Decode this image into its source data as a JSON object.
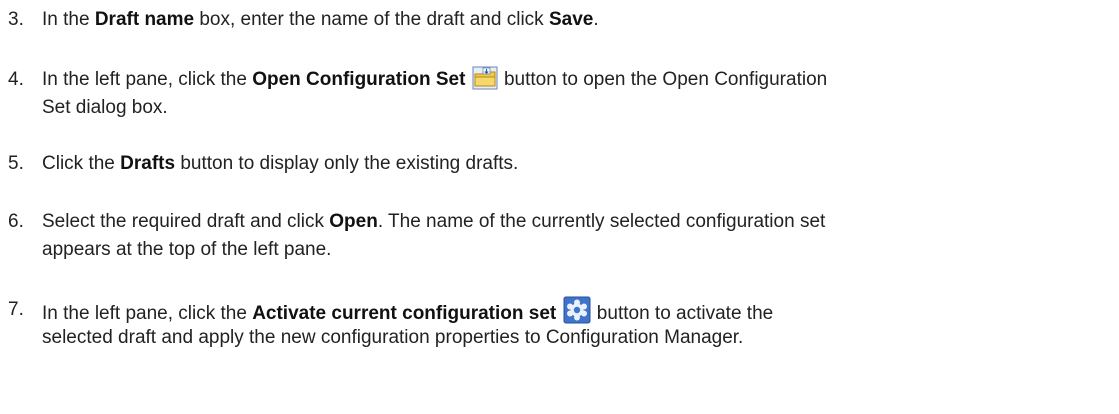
{
  "steps": [
    {
      "number": "3.",
      "line1": {
        "t1": "In the ",
        "b1": "Draft name",
        "t2": " box, enter the name of the draft and click ",
        "b2": "Save",
        "t3": "."
      }
    },
    {
      "number": "4.",
      "line1": {
        "t1": "In the left pane, click the ",
        "b1": "Open Configuration Set",
        "icon": "open-folder-icon",
        "t2": " button to open the Open Configuration"
      },
      "line2": "Set dialog box."
    },
    {
      "number": "5.",
      "line1": {
        "t1": "Click the ",
        "b1": "Drafts",
        "t2": " button to display only the existing drafts."
      }
    },
    {
      "number": "6.",
      "line1": {
        "t1": "Select the required draft and click ",
        "b1": "Open",
        "t2": ". The name of the currently selected configuration set"
      },
      "line2": "appears at the top of the left pane."
    },
    {
      "number": "7.",
      "line1": {
        "t1": "In the left pane, click the ",
        "b1": "Activate current configuration set",
        "icon": "activate-gear-icon",
        "t2": " button to activate the"
      },
      "line2": "selected draft and apply the new configuration properties to Configuration Manager."
    }
  ]
}
